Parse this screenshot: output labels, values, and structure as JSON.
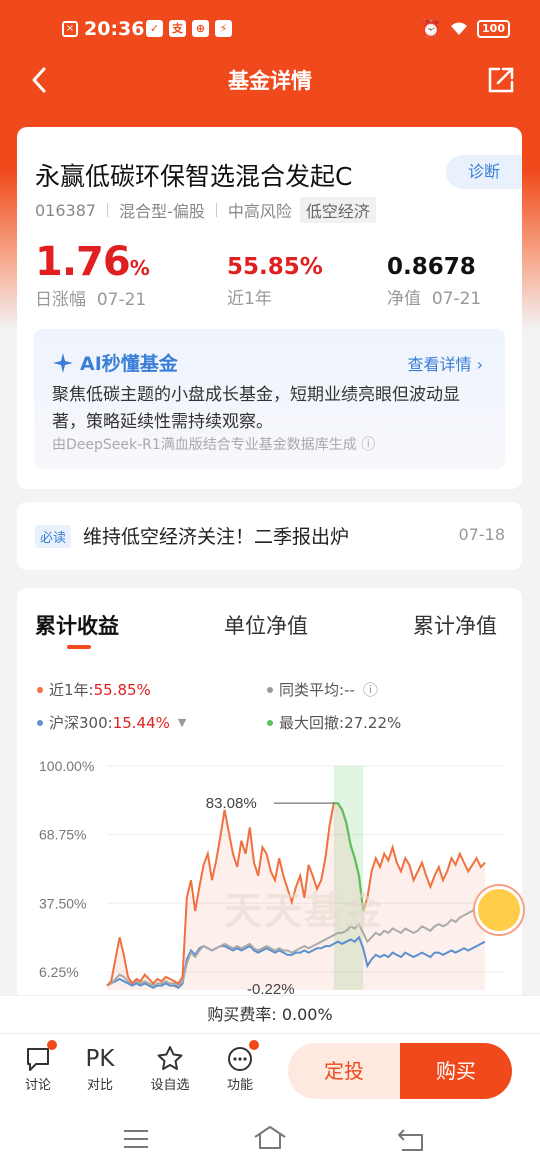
{
  "status_bar": {
    "time": "20:36",
    "battery": "100"
  },
  "nav": {
    "title": "基金详情"
  },
  "fund": {
    "name": "永赢低碳环保智选混合发起C",
    "diagnose_label": "诊断",
    "code": "016387",
    "type": "混合型-偏股",
    "risk": "中高风险",
    "theme_tag": "低空经济",
    "daily_change_value": "1.76",
    "daily_change_unit": "%",
    "daily_change_label": "日涨幅",
    "daily_change_date": "07-21",
    "one_year_value": "55.85%",
    "one_year_label": "近1年",
    "nav_value": "0.8678",
    "nav_label": "净值",
    "nav_date": "07-21"
  },
  "ai": {
    "title": "AI秒懂基金",
    "link": "查看详情",
    "text": "聚焦低碳主题的小盘成长基金，短期业绩亮眼但波动显著，策略延续性需持续观察。",
    "source": "由DeepSeek-R1满血版结合专业基金数据库生成"
  },
  "news": {
    "badge": "必读",
    "text": "维持低空经济关注！二季报出炉",
    "date": "07-18"
  },
  "chart_tabs": [
    "累计收益",
    "单位净值",
    "累计净值"
  ],
  "legend": {
    "fund_label": "近1年:",
    "fund_value": "55.85%",
    "avg_label": "同类平均:",
    "avg_value": "--",
    "index_label": "沪深300:",
    "index_value": "15.44%",
    "drawdown_label": "最大回撤:",
    "drawdown_value": "27.22%"
  },
  "colors": {
    "brand": "#f04a1c",
    "fund_line": "#f07040",
    "index_line": "#5b8fd0",
    "avg_line": "#aaaaaa",
    "drawdown": "#5cc05c"
  },
  "chart_data": {
    "type": "line",
    "ylim": [
      -2,
      100
    ],
    "y_ticks": [
      "100.00%",
      "68.75%",
      "37.50%",
      "6.25%"
    ],
    "annotations": {
      "max": "83.08%",
      "min": "-0.22%"
    },
    "series": [
      {
        "name": "近1年",
        "values": [
          0,
          2,
          12,
          22,
          14,
          4,
          1,
          3,
          2,
          5,
          3,
          1,
          3,
          2,
          4,
          3,
          2,
          1,
          4,
          40,
          48,
          34,
          45,
          55,
          60,
          48,
          57,
          68,
          80,
          70,
          60,
          54,
          66,
          60,
          72,
          56,
          50,
          63,
          60,
          52,
          48,
          58,
          50,
          44,
          38,
          45,
          50,
          40,
          55,
          50,
          44,
          48,
          58,
          73,
          83.08,
          83,
          80,
          74,
          64,
          58,
          50,
          34,
          40,
          52,
          58,
          54,
          60,
          57,
          63,
          56,
          52,
          58,
          55,
          48,
          52,
          56,
          50,
          45,
          50,
          54,
          48,
          52,
          58,
          55,
          60,
          56,
          52,
          55,
          58,
          54,
          56
        ]
      },
      {
        "name": "同类平均",
        "values": [
          0,
          1,
          3,
          5,
          4,
          2,
          1,
          2,
          1,
          2,
          1,
          0,
          1,
          1,
          2,
          1,
          1,
          0,
          2,
          10,
          15,
          13,
          16,
          18,
          17,
          16,
          17,
          18,
          19,
          18,
          17,
          18,
          17,
          18,
          19,
          17,
          16,
          17,
          18,
          17,
          16,
          17,
          16,
          16,
          15,
          16,
          17,
          18,
          17,
          18,
          19,
          20,
          21,
          22,
          23,
          24,
          24,
          25,
          27,
          26,
          28,
          24,
          20,
          22,
          24,
          23,
          25,
          24,
          26,
          25,
          24,
          26,
          25,
          24,
          25,
          27,
          26,
          25,
          27,
          28,
          27,
          28,
          30,
          29,
          31,
          32,
          33,
          34,
          36,
          38,
          40
        ]
      },
      {
        "name": "沪深300",
        "values": [
          0,
          1,
          2,
          3,
          2,
          1,
          0,
          1,
          0,
          1,
          0,
          -1,
          0,
          0,
          1,
          0,
          0,
          -1,
          1,
          12,
          16,
          14,
          17,
          18,
          17,
          16,
          17,
          18,
          18,
          17,
          16,
          17,
          16,
          17,
          18,
          16,
          15,
          16,
          17,
          16,
          15,
          16,
          15,
          14,
          14,
          15,
          15,
          16,
          15,
          16,
          17,
          17,
          18,
          18,
          19,
          20,
          19,
          20,
          21,
          20,
          22,
          17,
          9,
          12,
          14,
          13,
          14,
          13,
          15,
          14,
          13,
          15,
          14,
          13,
          14,
          15,
          14,
          13,
          15,
          15,
          14,
          15,
          16,
          15,
          16,
          17,
          16,
          17,
          18,
          19,
          20
        ]
      }
    ],
    "drawdown_range_index": [
      54,
      61
    ]
  },
  "fee": {
    "label": "购买费率:",
    "value": "0.00%"
  },
  "bottom": {
    "items": [
      {
        "label": "讨论",
        "icon": "chat-icon"
      },
      {
        "label": "对比",
        "icon": "pk-icon",
        "icon_text": "PK"
      },
      {
        "label": "设自选",
        "icon": "star-add-icon"
      },
      {
        "label": "功能",
        "icon": "more-icon"
      }
    ],
    "dingtou_label": "定投",
    "buy_label": "购买"
  }
}
